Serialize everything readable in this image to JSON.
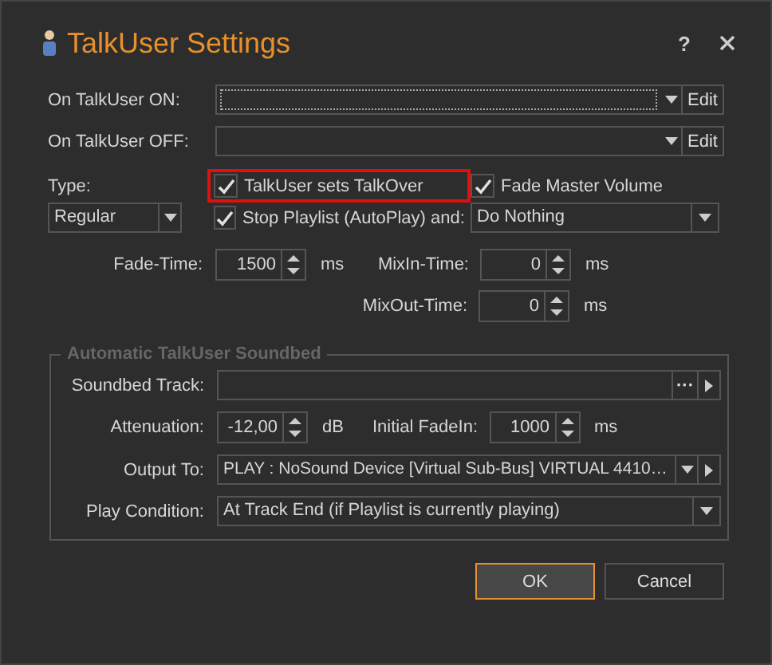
{
  "window": {
    "title": "TalkUser Settings",
    "help": "?"
  },
  "actions": [
    {
      "label": "On TalkUser ON:",
      "focused": true,
      "button": "Edit"
    },
    {
      "label": "On TalkUser OFF:",
      "focused": false,
      "button": "Edit"
    }
  ],
  "type": {
    "label": "Type:",
    "value": "Regular"
  },
  "options": [
    {
      "label": "TalkUser sets TalkOver",
      "checked": true,
      "highlighted": true
    },
    {
      "label": "Fade Master Volume",
      "checked": true,
      "highlighted": false
    },
    {
      "label": "Stop Playlist (AutoPlay) and:",
      "checked": true,
      "highlighted": false
    }
  ],
  "stop_action": "Do Nothing",
  "timings": [
    {
      "label": "Fade-Time:",
      "value": "1500",
      "unit": "ms"
    },
    {
      "label": "MixIn-Time:",
      "value": "0",
      "unit": "ms"
    },
    {
      "label": "MixOut-Time:",
      "value": "0",
      "unit": "ms"
    }
  ],
  "soundbed": {
    "title": "Automatic TalkUser Soundbed",
    "track_label": "Soundbed Track:",
    "browse": "···",
    "attenuation": {
      "label": "Attenuation:",
      "value": "-12,00",
      "unit": "dB"
    },
    "initial_fadein": {
      "label": "Initial FadeIn:",
      "value": "1000",
      "unit": "ms"
    },
    "output": {
      "label": "Output To:",
      "value": "PLAY : NoSound Device [Virtual Sub-Bus] VIRTUAL 4410…"
    },
    "play_condition": {
      "label": "Play Condition:",
      "value": "At Track End (if Playlist is currently playing)"
    }
  },
  "buttons": [
    {
      "label": "OK",
      "default": true
    },
    {
      "label": "Cancel",
      "default": false
    }
  ]
}
